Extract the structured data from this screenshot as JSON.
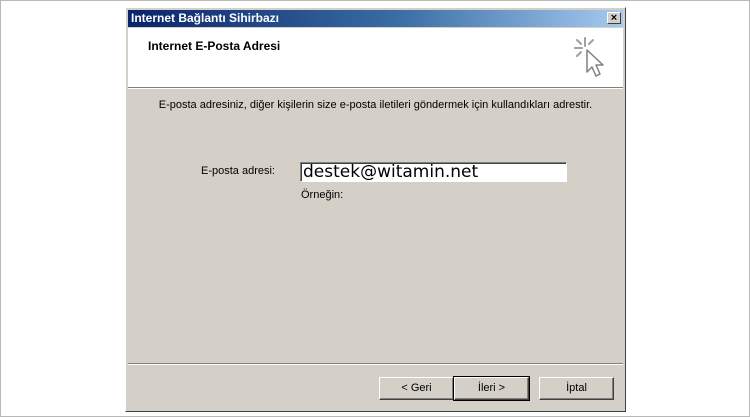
{
  "window": {
    "title": "Internet Bağlantı Sihirbazı",
    "close_label": "×"
  },
  "header": {
    "title": "Internet E-Posta Adresi",
    "icon": "wizard-cursor-icon"
  },
  "body": {
    "description": "E-posta adresiniz, diğer kişilerin size e-posta iletileri göndermek için kullandıkları adrestir.",
    "email_label": "E-posta adresi:",
    "email_value": "destek@witamin.net",
    "example_label": "Örneğin:"
  },
  "buttons": {
    "back": "< Geri",
    "next": "İleri >",
    "cancel": "İptal"
  },
  "colors": {
    "face": "#d4d0c8",
    "title_start": "#0a246a",
    "title_end": "#a6caf0"
  }
}
